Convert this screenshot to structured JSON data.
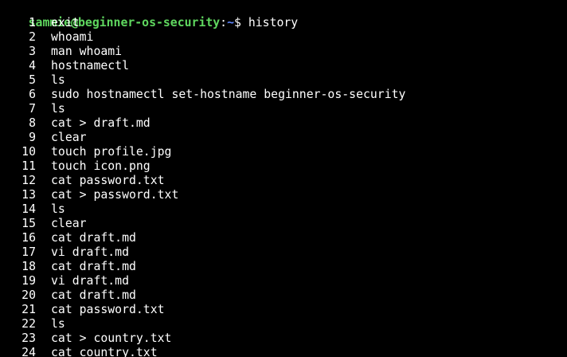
{
  "prompt": {
    "user_host": "sammie@beginner-os-security",
    "separator": ":",
    "path": "~",
    "symbol": "$",
    "command": "history"
  },
  "history": [
    {
      "n": "1",
      "cmd": "exit"
    },
    {
      "n": "2",
      "cmd": "whoami"
    },
    {
      "n": "3",
      "cmd": "man whoami"
    },
    {
      "n": "4",
      "cmd": "hostnamectl"
    },
    {
      "n": "5",
      "cmd": "ls"
    },
    {
      "n": "6",
      "cmd": "sudo hostnamectl set-hostname beginner-os-security"
    },
    {
      "n": "7",
      "cmd": "ls"
    },
    {
      "n": "8",
      "cmd": "cat > draft.md"
    },
    {
      "n": "9",
      "cmd": "clear"
    },
    {
      "n": "10",
      "cmd": "touch profile.jpg"
    },
    {
      "n": "11",
      "cmd": "touch icon.png"
    },
    {
      "n": "12",
      "cmd": "cat password.txt"
    },
    {
      "n": "13",
      "cmd": "cat > password.txt"
    },
    {
      "n": "14",
      "cmd": "ls"
    },
    {
      "n": "15",
      "cmd": "clear"
    },
    {
      "n": "16",
      "cmd": "cat draft.md"
    },
    {
      "n": "17",
      "cmd": "vi draft.md"
    },
    {
      "n": "18",
      "cmd": "cat draft.md"
    },
    {
      "n": "19",
      "cmd": "vi draft.md"
    },
    {
      "n": "20",
      "cmd": "cat draft.md"
    },
    {
      "n": "21",
      "cmd": "cat password.txt"
    },
    {
      "n": "22",
      "cmd": "ls"
    },
    {
      "n": "23",
      "cmd": "cat > country.txt"
    },
    {
      "n": "24",
      "cmd": "cat country.txt"
    }
  ],
  "colors": {
    "background": "#000000",
    "user_host": "#5fd75f",
    "path": "#5f87ff",
    "text": "#ffffff"
  }
}
